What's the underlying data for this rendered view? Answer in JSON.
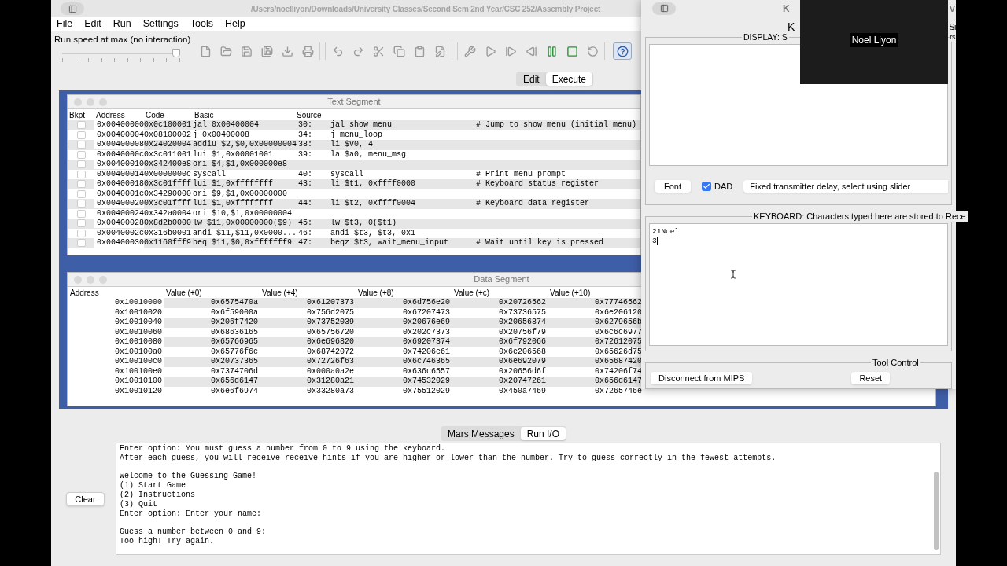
{
  "window": {
    "title": "/Users/noelliyon/Downloads/University Classes/Second Sem 2nd Year/CSC 252/Assembly Project"
  },
  "menu": [
    "File",
    "Edit",
    "Run",
    "Settings",
    "Tools",
    "Help"
  ],
  "run_speed": {
    "label": "Run speed at max (no interaction)",
    "level": 1
  },
  "view_tabs": [
    {
      "label": "Edit",
      "selected": false
    },
    {
      "label": "Execute",
      "selected": true
    }
  ],
  "text_segment": {
    "title": "Text Segment",
    "columns": [
      "Bkpt",
      "Address",
      "Code",
      "Basic",
      "Source"
    ],
    "rows": [
      {
        "breakpoint": false,
        "address": "0x00400000",
        "code": "0x0c100001",
        "basic": "jal 0x00400004",
        "line": "30:",
        "source": "jal show_menu",
        "comment": "# Jump to show_menu (initial menu)"
      },
      {
        "breakpoint": false,
        "address": "0x00400004",
        "code": "0x08100002",
        "basic": "j 0x00400008",
        "line": "34:",
        "source": "j menu_loop"
      },
      {
        "breakpoint": false,
        "address": "0x00400008",
        "code": "0x24020004",
        "basic": "addiu $2,$0,0x00000004",
        "line": "38:",
        "source": "li $v0, 4"
      },
      {
        "breakpoint": false,
        "address": "0x0040000c",
        "code": "0x3c011001",
        "basic": "lui $1,0x00001001",
        "line": "39:",
        "source": "la $a0, menu_msg"
      },
      {
        "breakpoint": false,
        "address": "0x00400010",
        "code": "0x342400e8",
        "basic": "ori $4,$1,0x000000e8"
      },
      {
        "breakpoint": false,
        "address": "0x00400014",
        "code": "0x0000000c",
        "basic": "syscall",
        "line": "40:",
        "source": "syscall",
        "comment": "# Print menu prompt"
      },
      {
        "breakpoint": false,
        "address": "0x00400018",
        "code": "0x3c01ffff",
        "basic": "lui $1,0xffffffff",
        "line": "43:",
        "source": "li $t1, 0xffff0000",
        "comment": "# Keyboard status register"
      },
      {
        "breakpoint": false,
        "address": "0x0040001c",
        "code": "0x34290000",
        "basic": "ori $9,$1,0x00000000"
      },
      {
        "breakpoint": false,
        "address": "0x00400020",
        "code": "0x3c01ffff",
        "basic": "lui $1,0xffffffff",
        "line": "44:",
        "source": "li $t2, 0xffff0004",
        "comment": "# Keyboard data register"
      },
      {
        "breakpoint": false,
        "address": "0x00400024",
        "code": "0x342a0004",
        "basic": "ori $10,$1,0x00000004"
      },
      {
        "breakpoint": false,
        "address": "0x00400028",
        "code": "0x8d2b0000",
        "basic": "lw $11,0x00000000($9)",
        "line": "45:",
        "source": "lw $t3, 0($t1)"
      },
      {
        "breakpoint": false,
        "address": "0x0040002c",
        "code": "0x316b0001",
        "basic": "andi $11,$11,0x0000...",
        "line": "46:",
        "source": "andi $t3, $t3, 0x1"
      },
      {
        "breakpoint": false,
        "address": "0x00400030",
        "code": "0x1160fff9",
        "basic": "beq $11,$0,0xfffffff9",
        "line": "47:",
        "source": "beqz $t3, wait_menu_input",
        "comment": "# Wait until key is pressed"
      }
    ]
  },
  "data_segment": {
    "title": "Data Segment",
    "columns": [
      "Address",
      "Value (+0)",
      "Value (+4)",
      "Value (+8)",
      "Value (+c)",
      "Value (+10)"
    ],
    "rows": [
      {
        "address": "0x10010000",
        "values": [
          "0x6575470a",
          "0x61207373",
          "0x6d756e20",
          "0x20726562",
          "0x77746562"
        ]
      },
      {
        "address": "0x10010020",
        "values": [
          "0x6f59000a",
          "0x756d2075",
          "0x67207473",
          "0x73736575",
          "0x6e206120"
        ]
      },
      {
        "address": "0x10010040",
        "values": [
          "0x206f7420",
          "0x73752039",
          "0x20676e69",
          "0x20656874",
          "0x6279656b"
        ]
      },
      {
        "address": "0x10010060",
        "values": [
          "0x68636165",
          "0x65756720",
          "0x202c7373",
          "0x20756f79",
          "0x6c6c6977"
        ]
      },
      {
        "address": "0x10010080",
        "values": [
          "0x65766965",
          "0x6e696820",
          "0x69207374",
          "0x6f792066",
          "0x72612075"
        ]
      },
      {
        "address": "0x100100a0",
        "values": [
          "0x65776f6c",
          "0x68742072",
          "0x74206e61",
          "0x6e206568",
          "0x65626d75"
        ]
      },
      {
        "address": "0x100100c0",
        "values": [
          "0x20737365",
          "0x72726f63",
          "0x6c746365",
          "0x6e692079",
          "0x65687420"
        ]
      },
      {
        "address": "0x100100e0",
        "values": [
          "0x7374706d",
          "0x000a0a2e",
          "0x636c6557",
          "0x20656d6f",
          "0x74206f74"
        ]
      },
      {
        "address": "0x10010100",
        "values": [
          "0x656d6147",
          "0x31280a21",
          "0x74532029",
          "0x20747261",
          "0x656d6147"
        ]
      },
      {
        "address": "0x10010120",
        "values": [
          "0x6e6f6974",
          "0x33280a73",
          "0x75512029",
          "0x450a7469",
          "0x7265746e"
        ]
      }
    ]
  },
  "keyboard_tool": {
    "window_title": "K",
    "window_title_end": "V",
    "heading": "K",
    "heading_end": "Si",
    "display_legend": "DISPLAY: S",
    "display_legend_end": "rs",
    "font_button": "Font",
    "dad": {
      "label": "DAD",
      "checked": true
    },
    "delay_mode": "Fixed transmitter delay, select using slider",
    "keyboard_legend": "KEYBOARD: Characters typed here are stored to Rece",
    "typed_lines": [
      "21Noel",
      "3"
    ],
    "tool_control_legend": "Tool Control",
    "buttons": [
      "Disconnect from MIPS",
      "Reset"
    ]
  },
  "video_tile": {
    "name": "Noel Liyon"
  },
  "message_tabs": [
    {
      "label": "Mars Messages",
      "selected": false
    },
    {
      "label": "Run I/O",
      "selected": true
    }
  ],
  "clear_button": "Clear",
  "run_io": {
    "paragraphs": [
      [
        "Enter option: You must guess a number from 0 to 9 using the keyboard.",
        "After each guess, you will receive receive hints if you are higher or lower than the number. Try to guess correctly in the fewest attempts."
      ],
      [
        "Welcome to the Guessing Game!",
        "(1) Start Game",
        "(2) Instructions",
        "(3) Quit",
        "Enter option: Enter your name:"
      ],
      [
        "Guess a number between 0 and 9:",
        "Too high! Try again."
      ]
    ]
  }
}
